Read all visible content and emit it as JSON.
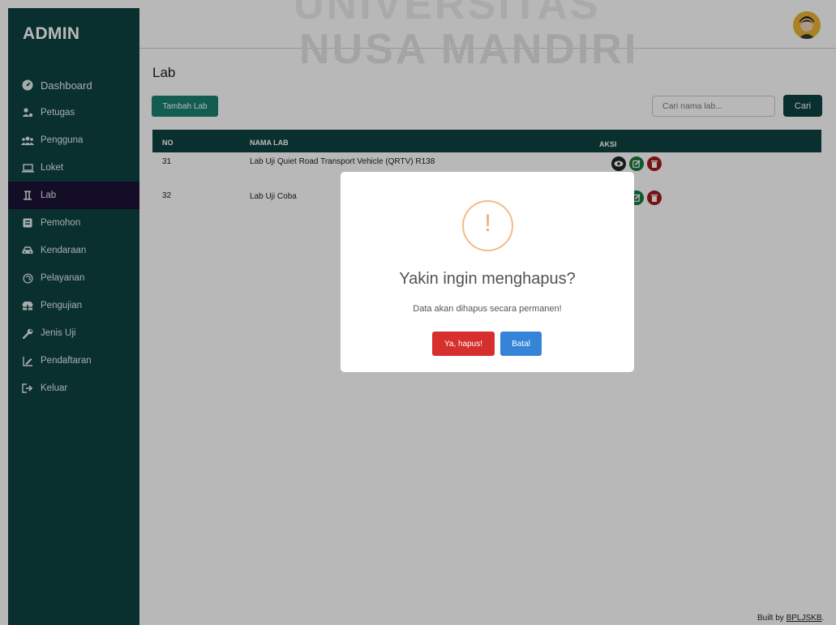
{
  "sidebar": {
    "brand": "ADMIN",
    "items": [
      {
        "label": "Dashboard",
        "icon": "gauge-icon"
      },
      {
        "label": "Petugas",
        "icon": "users-cog-icon"
      },
      {
        "label": "Pengguna",
        "icon": "users-icon"
      },
      {
        "label": "Loket",
        "icon": "laptop-icon"
      },
      {
        "label": "Lab",
        "icon": "flask-icon",
        "active": true
      },
      {
        "label": "Pemohon",
        "icon": "id-card-icon"
      },
      {
        "label": "Kendaraan",
        "icon": "car-icon"
      },
      {
        "label": "Pelayanan",
        "icon": "headset-icon"
      },
      {
        "label": "Pengujian",
        "icon": "clipboard-icon"
      },
      {
        "label": "Jenis Uji",
        "icon": "wrench-icon"
      },
      {
        "label": "Pendaftaran",
        "icon": "signature-icon"
      },
      {
        "label": "Keluar",
        "icon": "sign-out-icon"
      }
    ]
  },
  "watermark": {
    "line1": "UNIVERSITAS",
    "line2": "NUSA MANDIRI"
  },
  "page": {
    "title": "Lab",
    "add_button": "Tambah Lab",
    "search_placeholder": "Cari nama lab...",
    "search_button": "Cari"
  },
  "table": {
    "headers": [
      "NO",
      "NAMA LAB",
      "AKSI"
    ],
    "rows": [
      {
        "no": "31",
        "name": "Lab Uji Quiet Road Transport Vehicle (QRTV) R138"
      },
      {
        "no": "32",
        "name": "Lab Uji Coba"
      }
    ]
  },
  "footer": {
    "prefix": "Built by ",
    "link": "BPLJSKB",
    "suffix": "."
  },
  "modal": {
    "icon": "exclamation-mark",
    "title": "Yakin ingin menghapus?",
    "text": "Data akan dihapus secara permanen!",
    "confirm": "Ya, hapus!",
    "cancel": "Batal"
  },
  "colors": {
    "sidebar": "#0f4242",
    "active": "#1c1238",
    "danger": "#d72e2e",
    "primary": "#3584d8",
    "warning": "#f3bb88"
  }
}
